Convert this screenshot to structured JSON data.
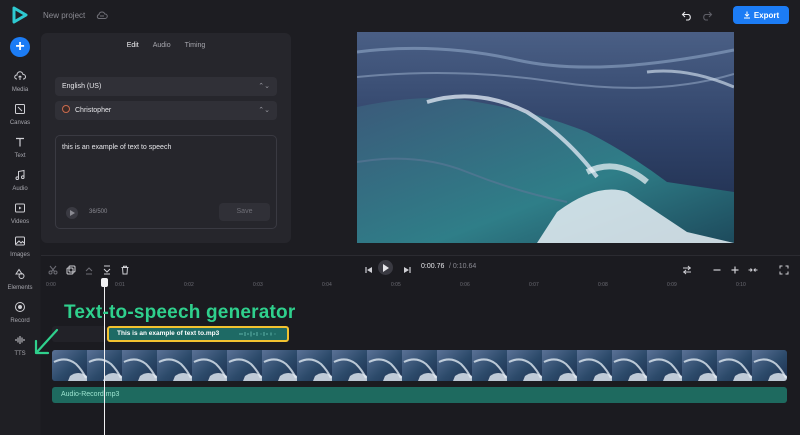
{
  "header": {
    "project_name": "New project",
    "export_label": "Export"
  },
  "rail": {
    "items": [
      {
        "label": "Media",
        "icon": "cloud-upload-icon"
      },
      {
        "label": "Canvas",
        "icon": "canvas-icon"
      },
      {
        "label": "Text",
        "icon": "text-icon"
      },
      {
        "label": "Audio",
        "icon": "music-note-icon"
      },
      {
        "label": "Videos",
        "icon": "video-icon"
      },
      {
        "label": "Images",
        "icon": "image-icon"
      },
      {
        "label": "Elements",
        "icon": "elements-icon"
      },
      {
        "label": "Record",
        "icon": "record-icon"
      },
      {
        "label": "TTS",
        "icon": "audio-wave-icon"
      }
    ]
  },
  "panel": {
    "tabs": [
      "Edit",
      "Audio",
      "Timing"
    ],
    "active_tab": "Edit",
    "language": "English (US)",
    "voice": "Christopher",
    "text": "this is an example of text to speech",
    "char_count": "36/500",
    "save_label": "Save"
  },
  "playback": {
    "current_time": "0:00.76",
    "total_time": "/ 0:10.64"
  },
  "ruler": {
    "ticks": [
      "0:00",
      "0:01",
      "0:02",
      "0:03",
      "0:04",
      "0:05",
      "0:06",
      "0:07",
      "0:08",
      "0:09",
      "0:10"
    ]
  },
  "tracks": {
    "tts_clip_label": "This is an example of text to.mp3",
    "audio_track_label": "Audio-Record.mp3"
  },
  "annotation": {
    "text": "Text-to-speech generator",
    "color": "#2fd08d"
  },
  "colors": {
    "accent": "#1c7cf5",
    "clip_border": "#f2c230",
    "audio_track": "#1e6a5f"
  }
}
